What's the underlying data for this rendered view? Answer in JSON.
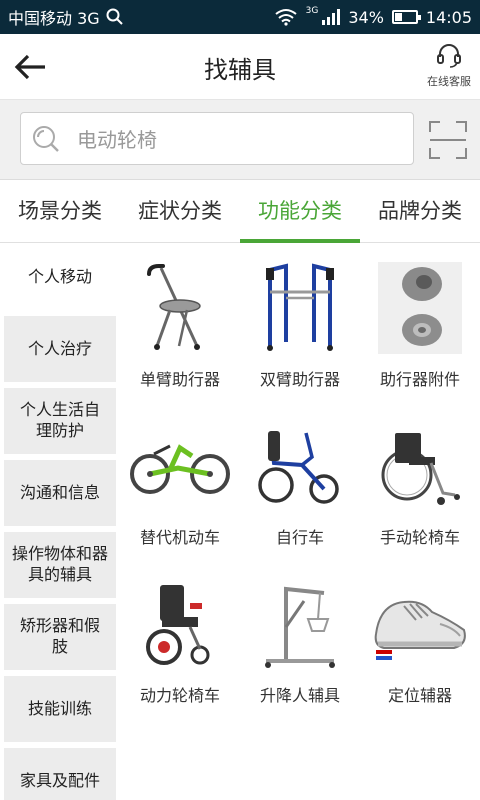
{
  "status": {
    "carrier": "中国移动 3G",
    "network_small": "3G",
    "battery": "34%",
    "battery_level": 0.34,
    "time": "14:05"
  },
  "header": {
    "title": "找辅具",
    "service_label": "在线客服"
  },
  "search": {
    "placeholder": "电动轮椅"
  },
  "tabs": [
    {
      "label": "场景分类",
      "active": false
    },
    {
      "label": "症状分类",
      "active": false
    },
    {
      "label": "功能分类",
      "active": true
    },
    {
      "label": "品牌分类",
      "active": false
    }
  ],
  "categories": [
    {
      "label": "个人移动",
      "active": true
    },
    {
      "label": "个人治疗",
      "active": false
    },
    {
      "label": "个人生活自理防护",
      "active": false
    },
    {
      "label": "沟通和信息",
      "active": false
    },
    {
      "label": "操作物体和器具的辅具",
      "active": false
    },
    {
      "label": "矫形器和假肢",
      "active": false
    },
    {
      "label": "技能训练",
      "active": false
    },
    {
      "label": "家具及配件",
      "active": false
    }
  ],
  "products": [
    {
      "name": "单臂助行器",
      "icon": "cane-seat-icon"
    },
    {
      "name": "双臂助行器",
      "icon": "walker-frame-icon"
    },
    {
      "name": "助行器附件",
      "icon": "rubber-tip-icon"
    },
    {
      "name": "替代机动车",
      "icon": "handcycle-icon"
    },
    {
      "name": "自行车",
      "icon": "hand-bike-icon"
    },
    {
      "name": "手动轮椅车",
      "icon": "manual-wheelchair-icon"
    },
    {
      "name": "动力轮椅车",
      "icon": "power-wheelchair-icon"
    },
    {
      "name": "升降人辅具",
      "icon": "patient-lift-icon"
    },
    {
      "name": "定位辅器",
      "icon": "shoe-icon"
    }
  ],
  "colors": {
    "accent": "#4aa637",
    "statusbar": "#0b2a3a",
    "category_bg": "#ececec"
  }
}
